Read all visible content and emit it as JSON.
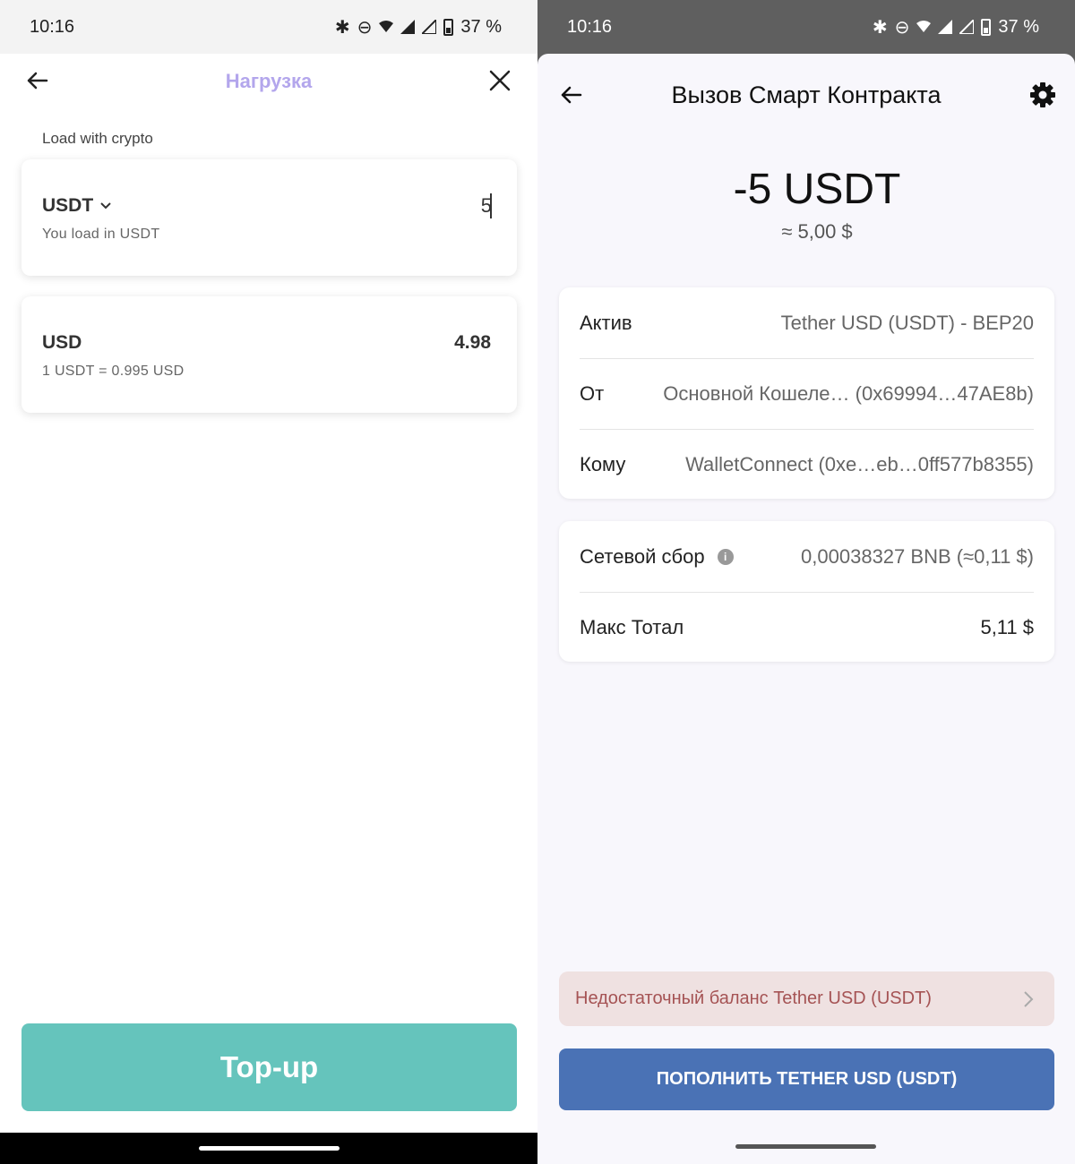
{
  "left": {
    "status": {
      "time": "10:16",
      "battery": "37 %"
    },
    "header": {
      "title": "Нагрузка"
    },
    "section_label": "Load with crypto",
    "pay_card": {
      "currency": "USDT",
      "subtitle": "You load in USDT",
      "input_value": "5"
    },
    "receive_card": {
      "currency": "USD",
      "subtitle": "1 USDT = 0.995 USD",
      "value": "4.98"
    },
    "topup_label": "Top-up",
    "colors": {
      "title": "#b3a6ec",
      "button": "#65c4bc"
    }
  },
  "right": {
    "status": {
      "time": "10:16",
      "battery": "37 %"
    },
    "header": {
      "title": "Вызов Смарт Контракта"
    },
    "amount": "-5 USDT",
    "amount_fiat": "≈ 5,00 $",
    "details": [
      {
        "label": "Актив",
        "value": "Tether USD (USDT) - BEP20"
      },
      {
        "label": "От",
        "value": "Основной Кошеле…  (0x69994…47AE8b)"
      },
      {
        "label": "Кому",
        "value": "WalletConnect (0xe…eb…0ff577b8355)"
      }
    ],
    "fees": [
      {
        "label": "Сетевой сбор",
        "value": "0,00038327 BNB (≈0,11 $)"
      },
      {
        "label": "Макс Тотал",
        "value": "5,11 $"
      }
    ],
    "warning": "Недостаточный баланс Tether USD (USDT)",
    "action_label": "ПОПОЛНИТЬ TETHER USD (USDT)",
    "colors": {
      "button": "#4a72b5",
      "warning_bg": "#efe1e1",
      "warning_text": "#a55354"
    }
  }
}
